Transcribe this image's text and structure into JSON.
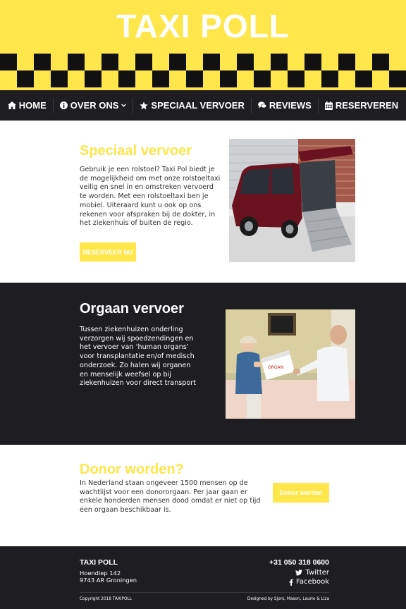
{
  "header": {
    "brand": "TAXI POLL"
  },
  "nav": {
    "items": [
      {
        "label": "HOME",
        "icon": "home-icon"
      },
      {
        "label": "OVER ONS",
        "icon": "info-icon",
        "has_dropdown": true
      },
      {
        "label": "SPECIAAL VERVOER",
        "icon": "star-icon"
      },
      {
        "label": "REVIEWS",
        "icon": "comments-icon"
      },
      {
        "label": "RESERVEREN",
        "icon": "calendar-icon"
      }
    ]
  },
  "speciaal": {
    "title": "Speciaal vervoer",
    "text": "Gebruik je een rolstoel? Taxi Pol biedt je de mogelijkheid om met onze rolstoeltaxi veilig en snel in  en omstreken vervoerd te worden. Met een rolstoeltaxi ben je mobiel. Uiteraard kunt u ook op ons rekenen voor afspraken bij de dokter, in het ziekenhuis of buiten de regio.",
    "button": "RESERVEER NU"
  },
  "orgaan": {
    "title": "Orgaan vervoer",
    "text": "Tussen ziekenhuizen onderling verzorgen wij spoedzendingen en het vervoer van ‘human organs’ voor transplantatie en/of medisch onderzoek. Zo halen wij organen en menselijk weefsel op bij ziekenhuizen voor direct transport"
  },
  "donor": {
    "title": "Donor worden?",
    "text": "In Nederland staan ongeveer 1500 mensen op de wachtlijst voor een donororgaan. Per jaar gaan er enkele honderden mensen dood omdat er niet op tijd een orgaan beschikbaar is.",
    "button": "Donor worden"
  },
  "footer": {
    "name": "TAXI POLL",
    "address_line1": "Hoendiep 142",
    "address_line2": "9743 AR Groningen",
    "phone": "+31 050 318 0600",
    "twitter": "Twitter",
    "facebook": "Facebook",
    "copyright": "Copyright 2018 TAXIPOLL",
    "credits": "Designed by Sjors, Mason, Laurie & Liza"
  },
  "colors": {
    "yellow": "#ffe64a",
    "dark": "#1e1d21",
    "white": "#ffffff"
  }
}
